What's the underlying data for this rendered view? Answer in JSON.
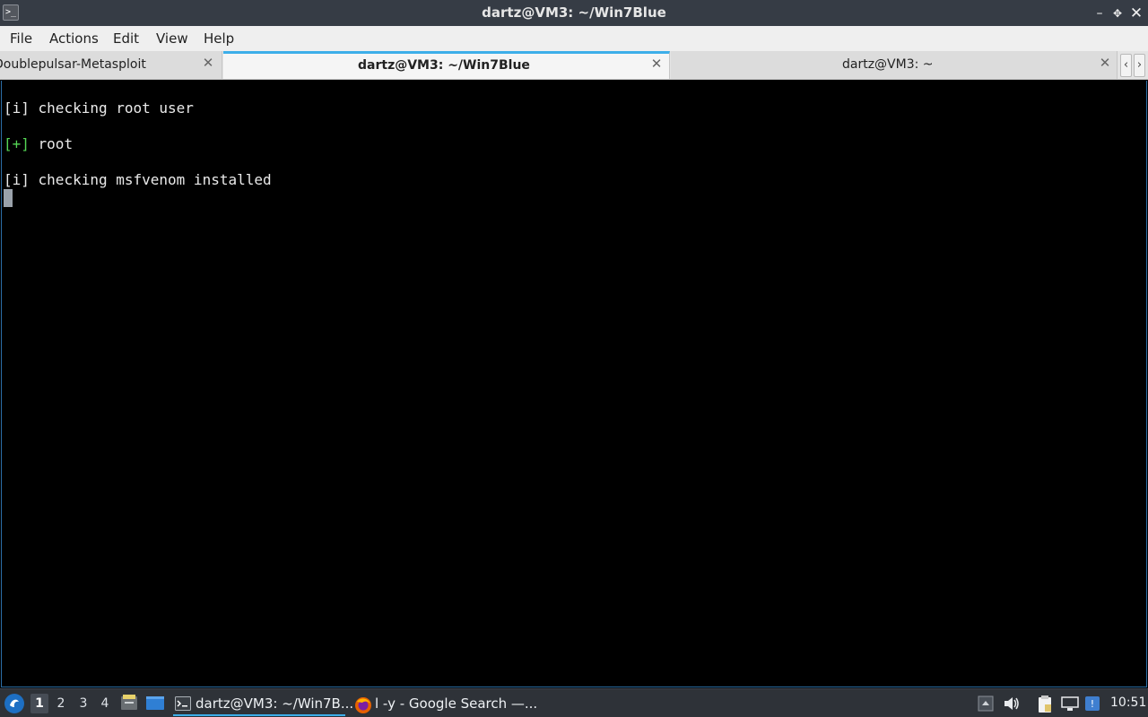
{
  "window": {
    "title": "dartz@VM3: ~/Win7Blue",
    "app_icon_glyph": ">_",
    "controls": {
      "minimize": "–",
      "maximize": "✥",
      "close": "✕"
    }
  },
  "menu": {
    "items": [
      {
        "label": "File"
      },
      {
        "label": "Actions"
      },
      {
        "label": "Edit"
      },
      {
        "label": "View"
      },
      {
        "label": "Help"
      }
    ]
  },
  "tabs": [
    {
      "label": "Doublepulsar-Metasploit",
      "active": false
    },
    {
      "label": "dartz@VM3: ~/Win7Blue",
      "active": true
    },
    {
      "label": "dartz@VM3: ~",
      "active": false
    }
  ],
  "tab_close_glyph": "✕",
  "tab_scroll": {
    "left": "‹",
    "right": "›"
  },
  "terminal": {
    "lines": [
      {
        "prefix": "[i]",
        "text": " checking root user"
      },
      {
        "prefix": "[+]",
        "text": " root"
      },
      {
        "prefix": "[i]",
        "text": " checking msfvenom installed"
      }
    ],
    "colors": {
      "background": "#000000",
      "text": "#eaeaea",
      "plus": "#55d655",
      "cursor": "#9aa2ab"
    }
  },
  "taskbar": {
    "start_icon": "start-menu-icon",
    "desktops": [
      "1",
      "2",
      "3",
      "4"
    ],
    "active_desktop": "1",
    "tasks": [
      {
        "label": "dartz@VM3: ~/Win7B...",
        "icon": "terminal-icon",
        "active": true
      },
      {
        "label": "l -y - Google Search —...",
        "icon": "firefox-icon",
        "active": false
      }
    ],
    "tray_icons": [
      "tray-expand-icon",
      "volume-icon",
      "clipboard-icon",
      "network-icon",
      "updates-icon"
    ],
    "clock": "10:51"
  },
  "accent_color": "#3daee9"
}
